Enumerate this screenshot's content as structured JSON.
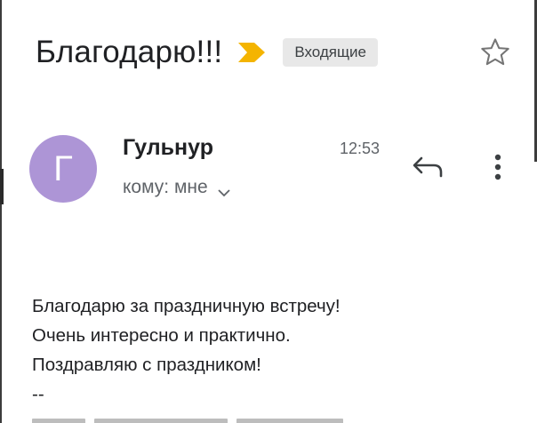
{
  "email": {
    "subject": "Благодарю!!!",
    "label": "Входящие",
    "sender_initial": "Г",
    "sender_name": "Гульнур",
    "time": "12:53",
    "recipient": "кому: мне",
    "body_lines": [
      "Благодарю за праздничную встречу!",
      "Очень интересно и практично.",
      "Поздравляю с праздником!",
      "--"
    ]
  },
  "colors": {
    "avatar": "#ad95d6",
    "importance": "#f4b400",
    "chip_bg": "#e8e8e8"
  },
  "icons": {
    "importance": "importance-marker-icon",
    "star": "star-icon",
    "reply": "reply-icon",
    "more": "more-vert-icon",
    "chevron": "chevron-down-icon"
  }
}
